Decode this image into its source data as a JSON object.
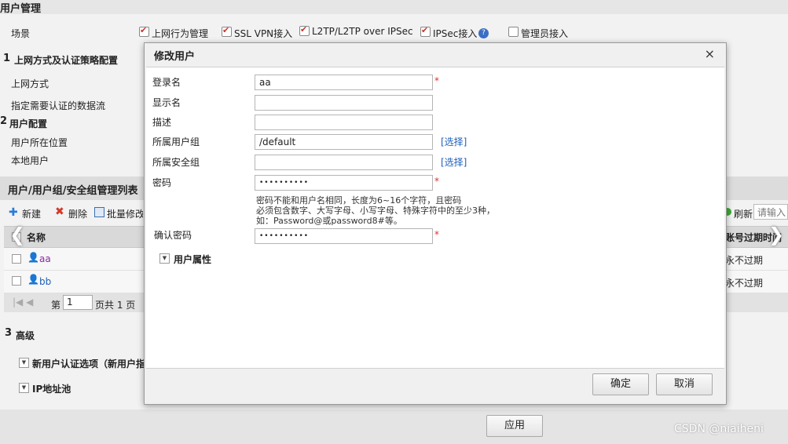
{
  "page": {
    "title": "用户管理",
    "scene_label": "场景",
    "scenes": [
      {
        "label": "上网行为管理",
        "checked": true
      },
      {
        "label": "SSL VPN接入",
        "checked": true
      },
      {
        "label": "L2TP/L2TP over IPSec",
        "checked": true
      },
      {
        "label": "IPSec接入",
        "checked": true
      },
      {
        "label": "管理员接入",
        "checked": false
      }
    ],
    "section1": {
      "num": "1",
      "title": "上网方式及认证策略配置",
      "rows": [
        "上网方式",
        "指定需要认证的数据流"
      ]
    },
    "section2": {
      "num": "2",
      "title": "用户配置",
      "rows": [
        "用户所在位置",
        "本地用户"
      ]
    },
    "list_title": "用户/用户组/安全组管理列表",
    "toolbar": {
      "new": "新建",
      "delete": "删除",
      "batch": "批量修改",
      "refresh": "刷新",
      "search_placeholder": "请输入"
    },
    "table": {
      "col_name": "名称",
      "col_expire": "账号过期时间",
      "rows": [
        {
          "name": "aa",
          "expire": "永不过期"
        },
        {
          "name": "bb",
          "expire": "永不过期"
        }
      ],
      "pager": {
        "page_prefix": "第",
        "page_value": "1",
        "page_suffix": "页共 1 页"
      }
    },
    "section3": {
      "num": "3",
      "title": "高级",
      "items": [
        "新用户认证选项（新用户指",
        "IP地址池"
      ]
    },
    "apply": "应用",
    "watermark": "CSDN @niaiheni"
  },
  "modal": {
    "title": "修改用户",
    "close": "×",
    "fields": {
      "login_label": "登录名",
      "login_value": "aa",
      "display_label": "显示名",
      "display_value": "",
      "desc_label": "描述",
      "desc_value": "",
      "group_label": "所属用户组",
      "group_value": "/default",
      "secgroup_label": "所属安全组",
      "secgroup_value": "",
      "pwd_label": "密码",
      "pwd_value": "••••••••••",
      "confirm_label": "确认密码",
      "confirm_value": "••••••••••",
      "select": "[选择]",
      "required": "*"
    },
    "hint_lines": [
      "密码不能和用户名相同，长度为6~16个字符，且密码",
      "必须包含数字、大写字母、小写字母、特殊字符中的至少3种，",
      "如：Password@或password8#等。"
    ],
    "user_attr": "用户属性",
    "ok": "确定",
    "cancel": "取消"
  },
  "colors": {
    "link": "#1e5fb8",
    "required": "#dd3333",
    "check": "#c0392b"
  }
}
